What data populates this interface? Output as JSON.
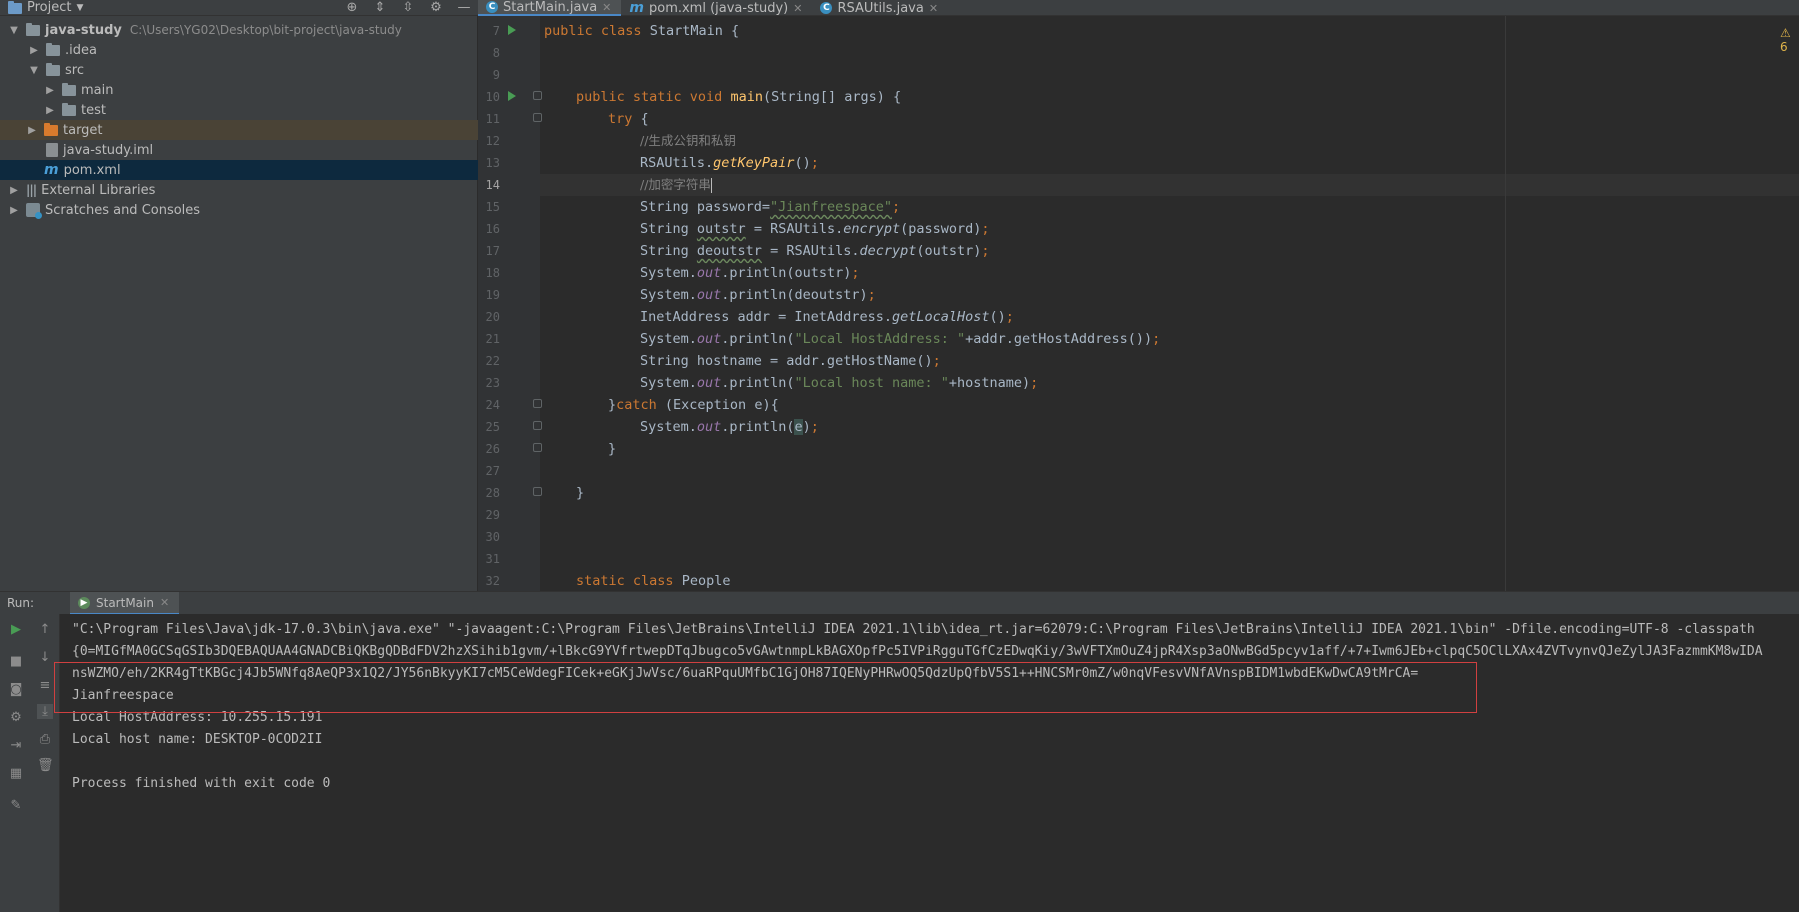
{
  "toolbar": {
    "project_label": "Project"
  },
  "tabs": [
    {
      "label": "StartMain.java",
      "icon": "class-icon",
      "active": true
    },
    {
      "label": "pom.xml (java-study)",
      "icon": "maven-icon",
      "active": false
    },
    {
      "label": "RSAUtils.java",
      "icon": "class-icon",
      "active": false
    }
  ],
  "tree": {
    "root": {
      "label": "java-study",
      "path": "C:\\Users\\YG02\\Desktop\\bit-project\\java-study"
    },
    "idea": ".idea",
    "src": "src",
    "main": "main",
    "test": "test",
    "target": "target",
    "iml": "java-study.iml",
    "pom": "pom.xml",
    "ext_libs": "External Libraries",
    "scratches": "Scratches and Consoles"
  },
  "editor": {
    "line_numbers": [
      "7",
      "8",
      "9",
      "10",
      "11",
      "12",
      "13",
      "14",
      "15",
      "16",
      "17",
      "18",
      "19",
      "20",
      "21",
      "22",
      "23",
      "24",
      "25",
      "26",
      "27",
      "28",
      "29",
      "30",
      "31",
      "32"
    ],
    "l7": {
      "kw1": "public",
      "kw2": "class",
      "name": "StartMain {"
    },
    "l10": {
      "kw": "public static void",
      "fn": "main",
      "rest": "(String[] args) {"
    },
    "l11": {
      "kw": "try",
      "rest": " {"
    },
    "l12": {
      "comment": "//生成公钥和私钥"
    },
    "l13": {
      "a": "RSAUtils.",
      "m": "getKeyPair",
      "b": "()",
      "semi": ";"
    },
    "l14": {
      "comment": "//加密字符串"
    },
    "l15": {
      "a": "String password=",
      "s": "\"Jianfreespace\"",
      "semi": ";"
    },
    "l16": {
      "a": "String ",
      "v": "outstr",
      "b": " = RSAUtils.",
      "m": "encrypt",
      "c": "(password)",
      "semi": ";"
    },
    "l17": {
      "a": "String ",
      "v": "deoutstr",
      "b": " = RSAUtils.",
      "m": "decrypt",
      "c": "(outstr)",
      "semi": ";"
    },
    "l18": {
      "a": "System.",
      "f": "out",
      "b": ".println(outstr)",
      "semi": ";"
    },
    "l19": {
      "a": "System.",
      "f": "out",
      "b": ".println(deoutstr)",
      "semi": ";"
    },
    "l20": {
      "a": "InetAddress addr = InetAddress.",
      "m": "getLocalHost",
      "b": "()",
      "semi": ";"
    },
    "l21": {
      "a": "System.",
      "f": "out",
      "b": ".println(",
      "s": "\"Local HostAddress: \"",
      "c": "+addr.getHostAddress())",
      "semi": ";"
    },
    "l22": {
      "a": "String hostname = addr.getHostName()",
      "semi": ";"
    },
    "l23": {
      "a": "System.",
      "f": "out",
      "b": ".println(",
      "s": "\"Local host name: \"",
      "c": "+hostname)",
      "semi": ";"
    },
    "l24": {
      "a": "}",
      "kw": "catch",
      "b": " (Exception e){"
    },
    "l25": {
      "a": "System.",
      "f": "out",
      "b": ".println(",
      "e": "e",
      "c": ")",
      "semi": ";"
    },
    "l26": "}",
    "l28": "}",
    "l32": {
      "kw": "static class",
      "name": "People"
    },
    "warning": "⚠ 6"
  },
  "run": {
    "label": "Run:",
    "tab": "StartMain",
    "lines": [
      "\"C:\\Program Files\\Java\\jdk-17.0.3\\bin\\java.exe\" \"-javaagent:C:\\Program Files\\JetBrains\\IntelliJ IDEA 2021.1\\lib\\idea_rt.jar=62079:C:\\Program Files\\JetBrains\\IntelliJ IDEA 2021.1\\bin\" -Dfile.encoding=UTF-8 -classpath",
      "{0=MIGfMA0GCSqGSIb3DQEBAQUAA4GNADCBiQKBgQDBdFDV2hzXSihib1gvm/+lBkcG9YVfrtwepDTqJbugco5vGAwtnmpLkBAGXOpfPc5IVPiRgguTGfCzEDwqKiy/3wVFTXmOuZ4jpR4Xsp3aONwBGd5pcyv1aff/+7+Iwm6JEb+clpqC5OClLXAx4ZVTvynvQJeZylJA3FazmmKM8wIDA",
      "nsWZMO/eh/2KR4gTtKBGcj4Jb5WNfq8AeQP3x1Q2/JY56nBkyyKI7cM5CeWdegFICek+eGKjJwVsc/6uaRPquUMfbC1GjOH87IQENyPHRwOQ5QdzUpQfbV5S1++HNCSMr0mZ/w0nqVFesvVNfAVnspBIDM1wbdEKwDwCA9tMrCA=",
      "Jianfreespace",
      "Local HostAddress: 10.255.15.191",
      "Local host name: DESKTOP-0COD2II",
      "",
      "Process finished with exit code 0"
    ]
  }
}
